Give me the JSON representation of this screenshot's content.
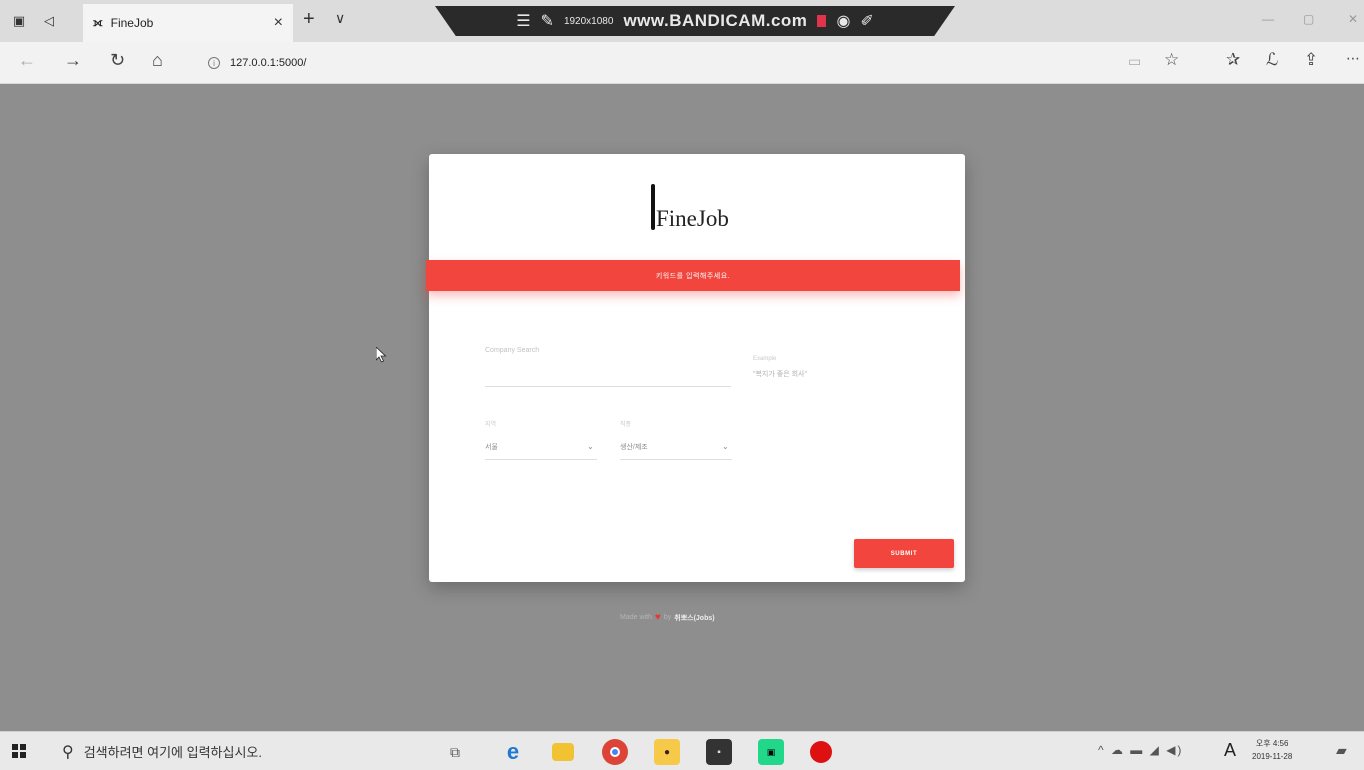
{
  "browser": {
    "tab_title": "FineJob",
    "tab_close": "×",
    "new_tab": "+",
    "tab_dropdown": "∨",
    "url": "127.0.0.1:5000/",
    "recorder": {
      "resolution": "1920x1080",
      "brand": "www.BANDICAM.com"
    }
  },
  "page": {
    "logo_text": "FineJob",
    "alert_message": "키워드를 입력해주세요.",
    "search": {
      "label": "Company Search",
      "example_label": "Example",
      "example_text": "\"복지가 좋은 회사\""
    },
    "selects": [
      {
        "label": "지역",
        "value": "서울"
      },
      {
        "label": "직종",
        "value": "생산/제조"
      }
    ],
    "submit_label": "SUBMIT",
    "footer": {
      "prefix": "Made with",
      "heart": "♥",
      "by": "by",
      "team": "취뽀스(Jobs)"
    }
  },
  "taskbar": {
    "search_placeholder": "검색하려면 여기에 입력하십시오.",
    "ime": "A",
    "time": "오후 4:56",
    "date": "2019-11-28"
  },
  "colors": {
    "accent": "#f1453d",
    "page_background": "#8e8e8e"
  }
}
